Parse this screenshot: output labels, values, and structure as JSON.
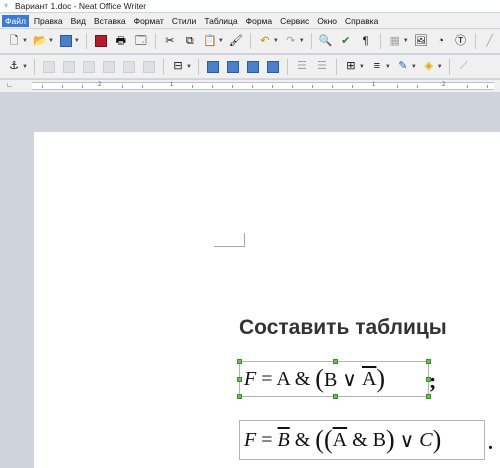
{
  "window": {
    "title": "Вариант 1.doc - Neat Office Writer"
  },
  "menu": [
    "Файл",
    "Правка",
    "Вид",
    "Вставка",
    "Формат",
    "Стили",
    "Таблица",
    "Форма",
    "Сервис",
    "Окно",
    "Справка"
  ],
  "ruler": {
    "numbers": [
      "2",
      "1",
      "1",
      "2"
    ]
  },
  "document": {
    "heading": "Составить таблицы",
    "formula1": {
      "F": "F",
      "eq": " = A & ",
      "lp": "(",
      "B": "B ∨ ",
      "Abar": "A",
      "rp": ")",
      "after": ";"
    },
    "formula2": {
      "F": "F",
      "eq": " = ",
      "Bbar": "B",
      "amp": " & ",
      "lp2": "((",
      "Abar": "A",
      "mid": " & B",
      "rp1": ")",
      "or": " ∨ ",
      "C": "C",
      "rp2": ")",
      "after": "."
    }
  },
  "icons": {
    "new": "new-document-icon",
    "open": "open-icon",
    "save": "save-icon",
    "pdf": "export-pdf-icon",
    "print": "print-icon",
    "preview": "print-preview-icon",
    "cut": "cut-icon",
    "copy": "copy-icon",
    "paste": "paste-icon",
    "clone": "clone-formatting-icon",
    "undo": "undo-icon",
    "redo": "redo-icon",
    "find": "find-replace-icon",
    "spell": "spelling-icon",
    "pilcrow": "formatting-marks-icon",
    "table": "insert-table-icon",
    "image": "insert-image-icon",
    "chart": "insert-chart-icon",
    "textbox": "insert-textbox-icon",
    "anchor": "anchor-icon"
  },
  "colors": {
    "menu_active_bg": "#3a7bd5",
    "workspace_bg": "#cfd4db",
    "handle": "#6cc04a"
  }
}
